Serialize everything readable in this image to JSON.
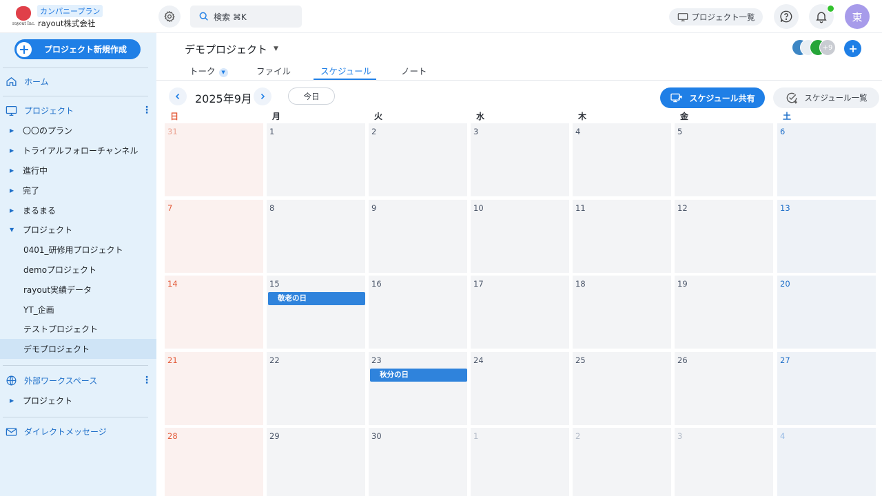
{
  "app": {
    "plan_badge": "カンパニープラン",
    "company": "rayout株式会社",
    "logo_caption": "rayout Inc.",
    "search_placeholder": "検索 ⌘K",
    "project_list_label": "プロジェクト一覧",
    "user_initial": "東",
    "accent_color": "#1f7fe6"
  },
  "sidebar": {
    "new_project_label": "プロジェクト新規作成",
    "home": "ホーム",
    "projects_header": "プロジェクト",
    "project_groups": [
      "〇〇のプラン",
      "トライアルフォローチャンネル",
      "進行中",
      "完了",
      "まるまる",
      "プロジェクト"
    ],
    "project_items": [
      "0401_研修用プロジェクト",
      "demoプロジェクト",
      "rayout実績データ",
      "YT_企画",
      "テストプロジェクト",
      "デモプロジェクト"
    ],
    "selected_item": "デモプロジェクト",
    "external_header": "外部ワークスペース",
    "external_groups": [
      "プロジェクト"
    ],
    "direct_message": "ダイレクトメッセージ"
  },
  "header": {
    "project_title": "デモプロジェクト",
    "member_extra": "+9",
    "tabs": [
      "トーク",
      "ファイル",
      "スケジュール",
      "ノート"
    ],
    "active_tab": "スケジュール"
  },
  "calendar": {
    "month_label": "2025年9月",
    "today_label": "今日",
    "share_label": "スケジュール共有",
    "list_label": "スケジュール一覧",
    "weekdays": [
      "日",
      "月",
      "火",
      "水",
      "木",
      "金",
      "土"
    ],
    "weeks": [
      [
        {
          "d": "31",
          "other": true
        },
        {
          "d": "1"
        },
        {
          "d": "2"
        },
        {
          "d": "3"
        },
        {
          "d": "4"
        },
        {
          "d": "5"
        },
        {
          "d": "6"
        }
      ],
      [
        {
          "d": "7"
        },
        {
          "d": "8"
        },
        {
          "d": "9"
        },
        {
          "d": "10"
        },
        {
          "d": "11"
        },
        {
          "d": "12"
        },
        {
          "d": "13"
        }
      ],
      [
        {
          "d": "14"
        },
        {
          "d": "15",
          "event": "敬老の日"
        },
        {
          "d": "16"
        },
        {
          "d": "17"
        },
        {
          "d": "18"
        },
        {
          "d": "19"
        },
        {
          "d": "20"
        }
      ],
      [
        {
          "d": "21"
        },
        {
          "d": "22"
        },
        {
          "d": "23",
          "event": "秋分の日"
        },
        {
          "d": "24"
        },
        {
          "d": "25"
        },
        {
          "d": "26"
        },
        {
          "d": "27"
        }
      ],
      [
        {
          "d": "28"
        },
        {
          "d": "29"
        },
        {
          "d": "30"
        },
        {
          "d": "1",
          "other": true
        },
        {
          "d": "2",
          "other": true
        },
        {
          "d": "3",
          "other": true
        },
        {
          "d": "4",
          "other": true
        }
      ]
    ]
  }
}
